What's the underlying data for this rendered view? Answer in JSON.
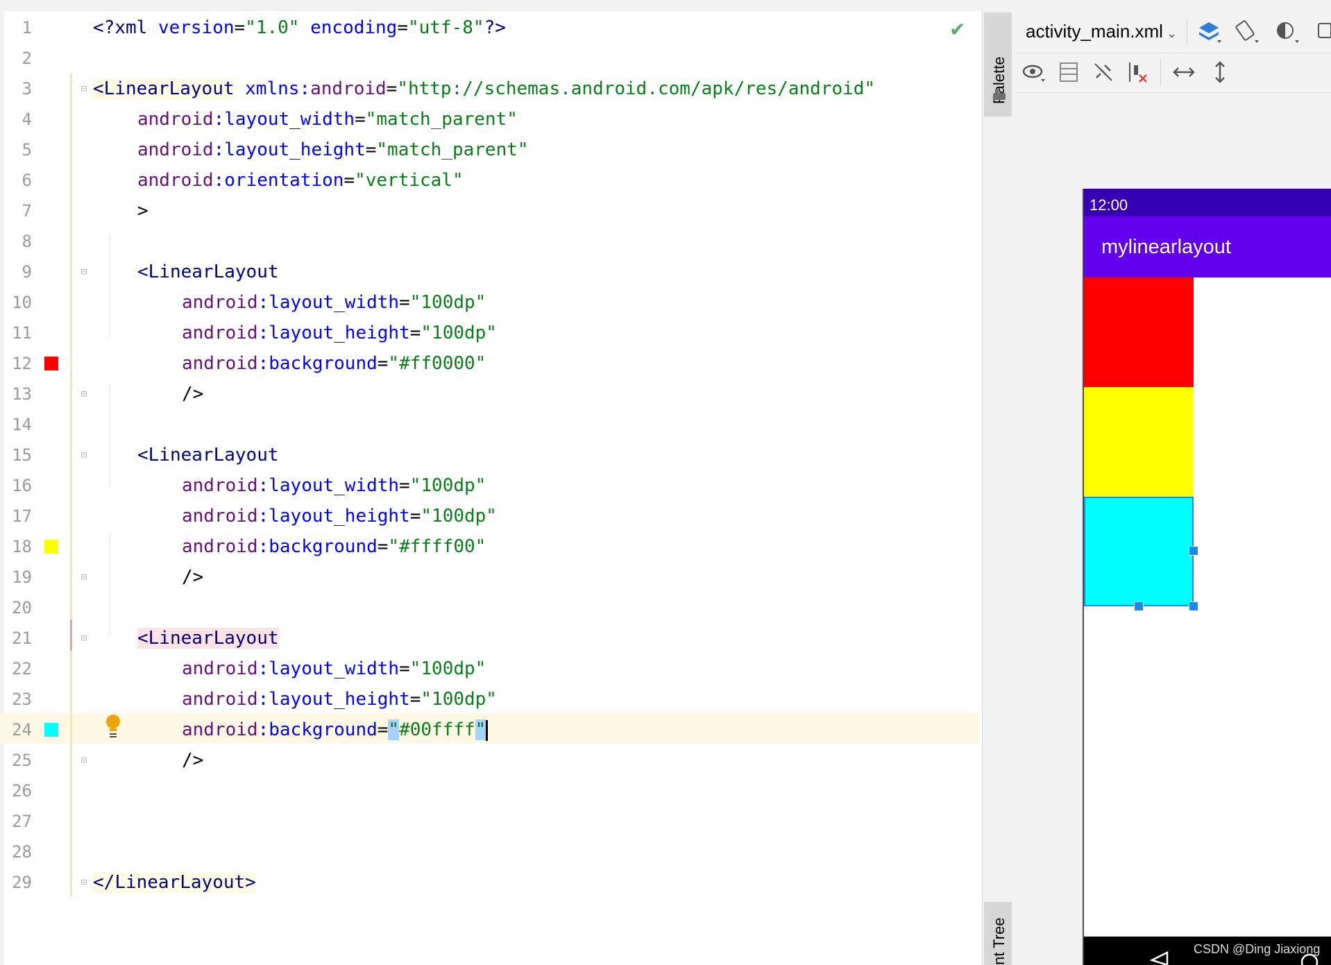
{
  "editor": {
    "lines": [
      {
        "n": "1"
      },
      {
        "n": "2"
      },
      {
        "n": "3"
      },
      {
        "n": "4"
      },
      {
        "n": "5"
      },
      {
        "n": "6"
      },
      {
        "n": "7"
      },
      {
        "n": "8"
      },
      {
        "n": "9"
      },
      {
        "n": "10"
      },
      {
        "n": "11"
      },
      {
        "n": "12"
      },
      {
        "n": "13"
      },
      {
        "n": "14"
      },
      {
        "n": "15"
      },
      {
        "n": "16"
      },
      {
        "n": "17"
      },
      {
        "n": "18"
      },
      {
        "n": "19"
      },
      {
        "n": "20"
      },
      {
        "n": "21"
      },
      {
        "n": "22"
      },
      {
        "n": "23"
      },
      {
        "n": "24"
      },
      {
        "n": "25"
      },
      {
        "n": "26"
      },
      {
        "n": "27"
      },
      {
        "n": "28"
      },
      {
        "n": "29"
      }
    ],
    "code": {
      "l1": {
        "a": "<?",
        "b": "xml",
        "c": " version",
        "d": "=",
        "e": "\"1.0\"",
        "f": " encoding",
        "g": "=",
        "h": "\"utf-8\"",
        "i": "?>"
      },
      "l3": {
        "a": "<",
        "b": "LinearLayout",
        "c": " xmlns:",
        "d": "android",
        "e": "=",
        "f": "\"http://schemas.android.com/apk/res/android\""
      },
      "l4": {
        "ns": "android",
        "attr": ":layout_width",
        "eq": "=",
        "val": "\"match_parent\""
      },
      "l5": {
        "ns": "android",
        "attr": ":layout_height",
        "eq": "=",
        "val": "\"match_parent\""
      },
      "l6": {
        "ns": "android",
        "attr": ":orientation",
        "eq": "=",
        "val": "\"vertical\""
      },
      "l7": {
        "t": ">"
      },
      "l9": {
        "a": "<",
        "b": "LinearLayout"
      },
      "l10": {
        "ns": "android",
        "attr": ":layout_width",
        "eq": "=",
        "val": "\"100dp\""
      },
      "l11": {
        "ns": "android",
        "attr": ":layout_height",
        "eq": "=",
        "val": "\"100dp\""
      },
      "l12": {
        "ns": "android",
        "attr": ":background",
        "eq": "=",
        "val": "\"#ff0000\""
      },
      "l13": {
        "t": "/>"
      },
      "l15": {
        "a": "<",
        "b": "LinearLayout"
      },
      "l16": {
        "ns": "android",
        "attr": ":layout_width",
        "eq": "=",
        "val": "\"100dp\""
      },
      "l17": {
        "ns": "android",
        "attr": ":layout_height",
        "eq": "=",
        "val": "\"100dp\""
      },
      "l18": {
        "ns": "android",
        "attr": ":background",
        "eq": "=",
        "val": "\"#ffff00\""
      },
      "l19": {
        "t": "/>"
      },
      "l21": {
        "a": "<",
        "b": "LinearLayout"
      },
      "l22": {
        "ns": "android",
        "attr": ":layout_width",
        "eq": "=",
        "val": "\"100dp\""
      },
      "l23": {
        "ns": "android",
        "attr": ":layout_height",
        "eq": "=",
        "val": "\"100dp\""
      },
      "l24": {
        "ns": "android",
        "attr": ":background",
        "eq": "=",
        "q1": "\"",
        "val": "#00ffff",
        "q2": "\""
      },
      "l25": {
        "t": "/>"
      },
      "l29": {
        "a": "</",
        "b": "LinearLayout",
        "c": ">"
      }
    },
    "swatches": {
      "red": "#ff0000",
      "yellow": "#ffff00",
      "cyan": "#00ffff"
    },
    "status_icon": "check-icon"
  },
  "side_tabs": {
    "palette": "Palette",
    "component_tree": "nt Tree"
  },
  "design_toolbar": {
    "file_name": "activity_main.xml",
    "icons": [
      "design-surface-icon",
      "orientation-icon",
      "theme-icon",
      "device-icon",
      "view-options-icon",
      "blueprint-icon",
      "autoconnect-icon",
      "clear-constraints-icon",
      "expand-horizontal-icon",
      "expand-vertical-icon"
    ]
  },
  "preview": {
    "status_time": "12:00",
    "app_title": "mylinearlayout",
    "boxes": [
      {
        "color": "#ff0000"
      },
      {
        "color": "#ffff00"
      },
      {
        "color": "#00ffff"
      }
    ],
    "watermark": "CSDN @Ding Jiaxiong"
  }
}
